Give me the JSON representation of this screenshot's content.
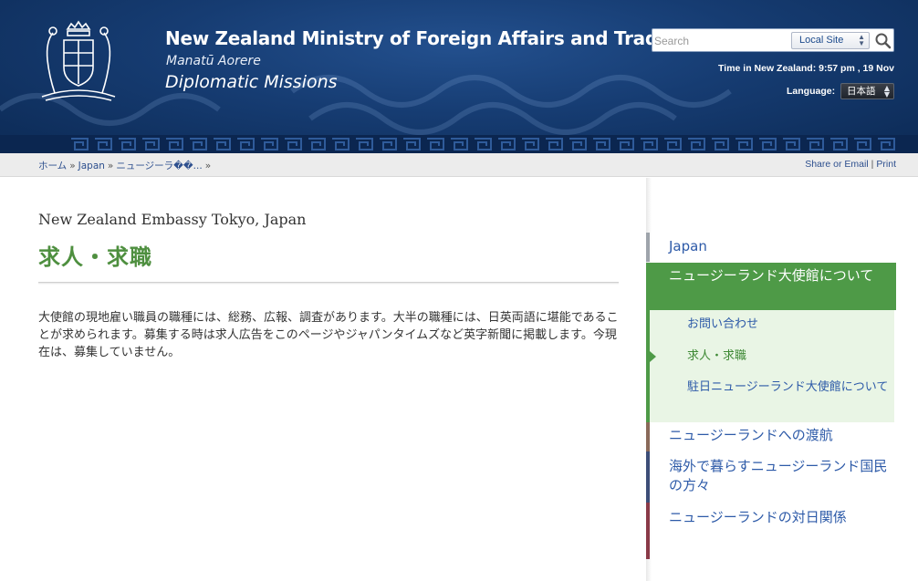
{
  "header": {
    "org_title": "New Zealand Ministry of Foreign Affairs and Trade",
    "maori_name": "Manatū Aorere",
    "section_name": "Diplomatic Missions",
    "search": {
      "placeholder": "Search",
      "scope": "Local Site"
    },
    "time_text": "Time in New Zealand: 9:57 pm , 19 Nov",
    "language_label": "Language:",
    "language_value": "日本語"
  },
  "breadcrumb": {
    "items": [
      "ホーム",
      "Japan",
      "ニュージーラ��..."
    ],
    "separator": "»"
  },
  "tools": {
    "share": "Share or Email",
    "print": "Print"
  },
  "main": {
    "embassy": "New Zealand Embassy Tokyo, Japan",
    "title": "求人・求職",
    "body": "大使館の現地雇い職員の職種には、総務、広報、調査があります。大半の職種には、日英両語に堪能であることが求められます。募集する時は求人広告をこのページやジャパンタイムズなど英字新聞に掲載します。今現在は、募集していません。"
  },
  "sidebar": {
    "japan": "Japan",
    "active": "ニュージーランド大使館について",
    "subitems": [
      "お問い合わせ",
      "求人・求職",
      "駐日ニュージーランド大使館について"
    ],
    "travel": "ニュージーランドへの渡航",
    "abroad": "海外で暮らすニュージーランド国民の方々",
    "relations": "ニュージーランドの対日関係"
  },
  "colors": {
    "header_blue": "#163c72",
    "accent_green": "#4e9a47",
    "link_blue": "#2d5aa8"
  }
}
